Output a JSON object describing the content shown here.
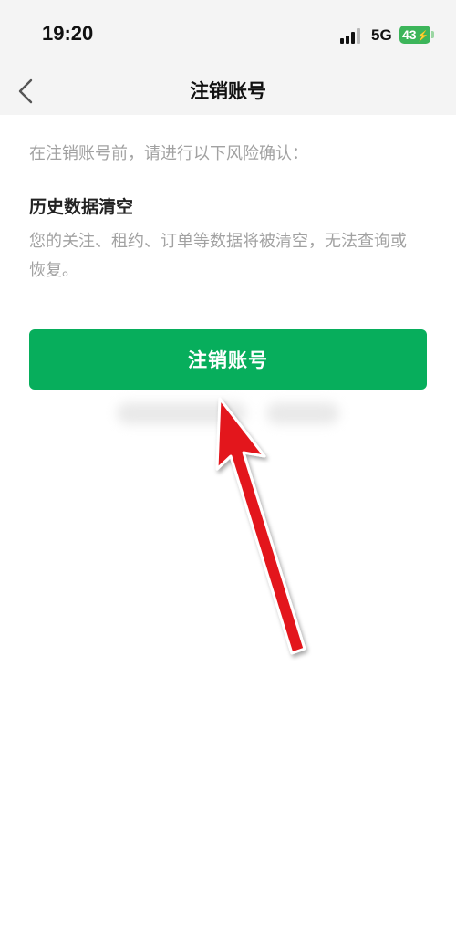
{
  "status_bar": {
    "time": "19:20",
    "network": "5G",
    "battery": "43",
    "battery_color": "#3cb55a"
  },
  "nav": {
    "title": "注销账号",
    "back_icon": "chevron-left-icon"
  },
  "content": {
    "intro": "在注销账号前，请进行以下风险确认：",
    "section_title": "历史数据清空",
    "section_desc": "您的关注、租约、订单等数据将被清空，无法查询或恢复。"
  },
  "button": {
    "label": "注销账号",
    "color": "#07ae5c"
  },
  "annotation": {
    "arrow_icon": "red-arrow-icon",
    "color": "#e3151c"
  }
}
